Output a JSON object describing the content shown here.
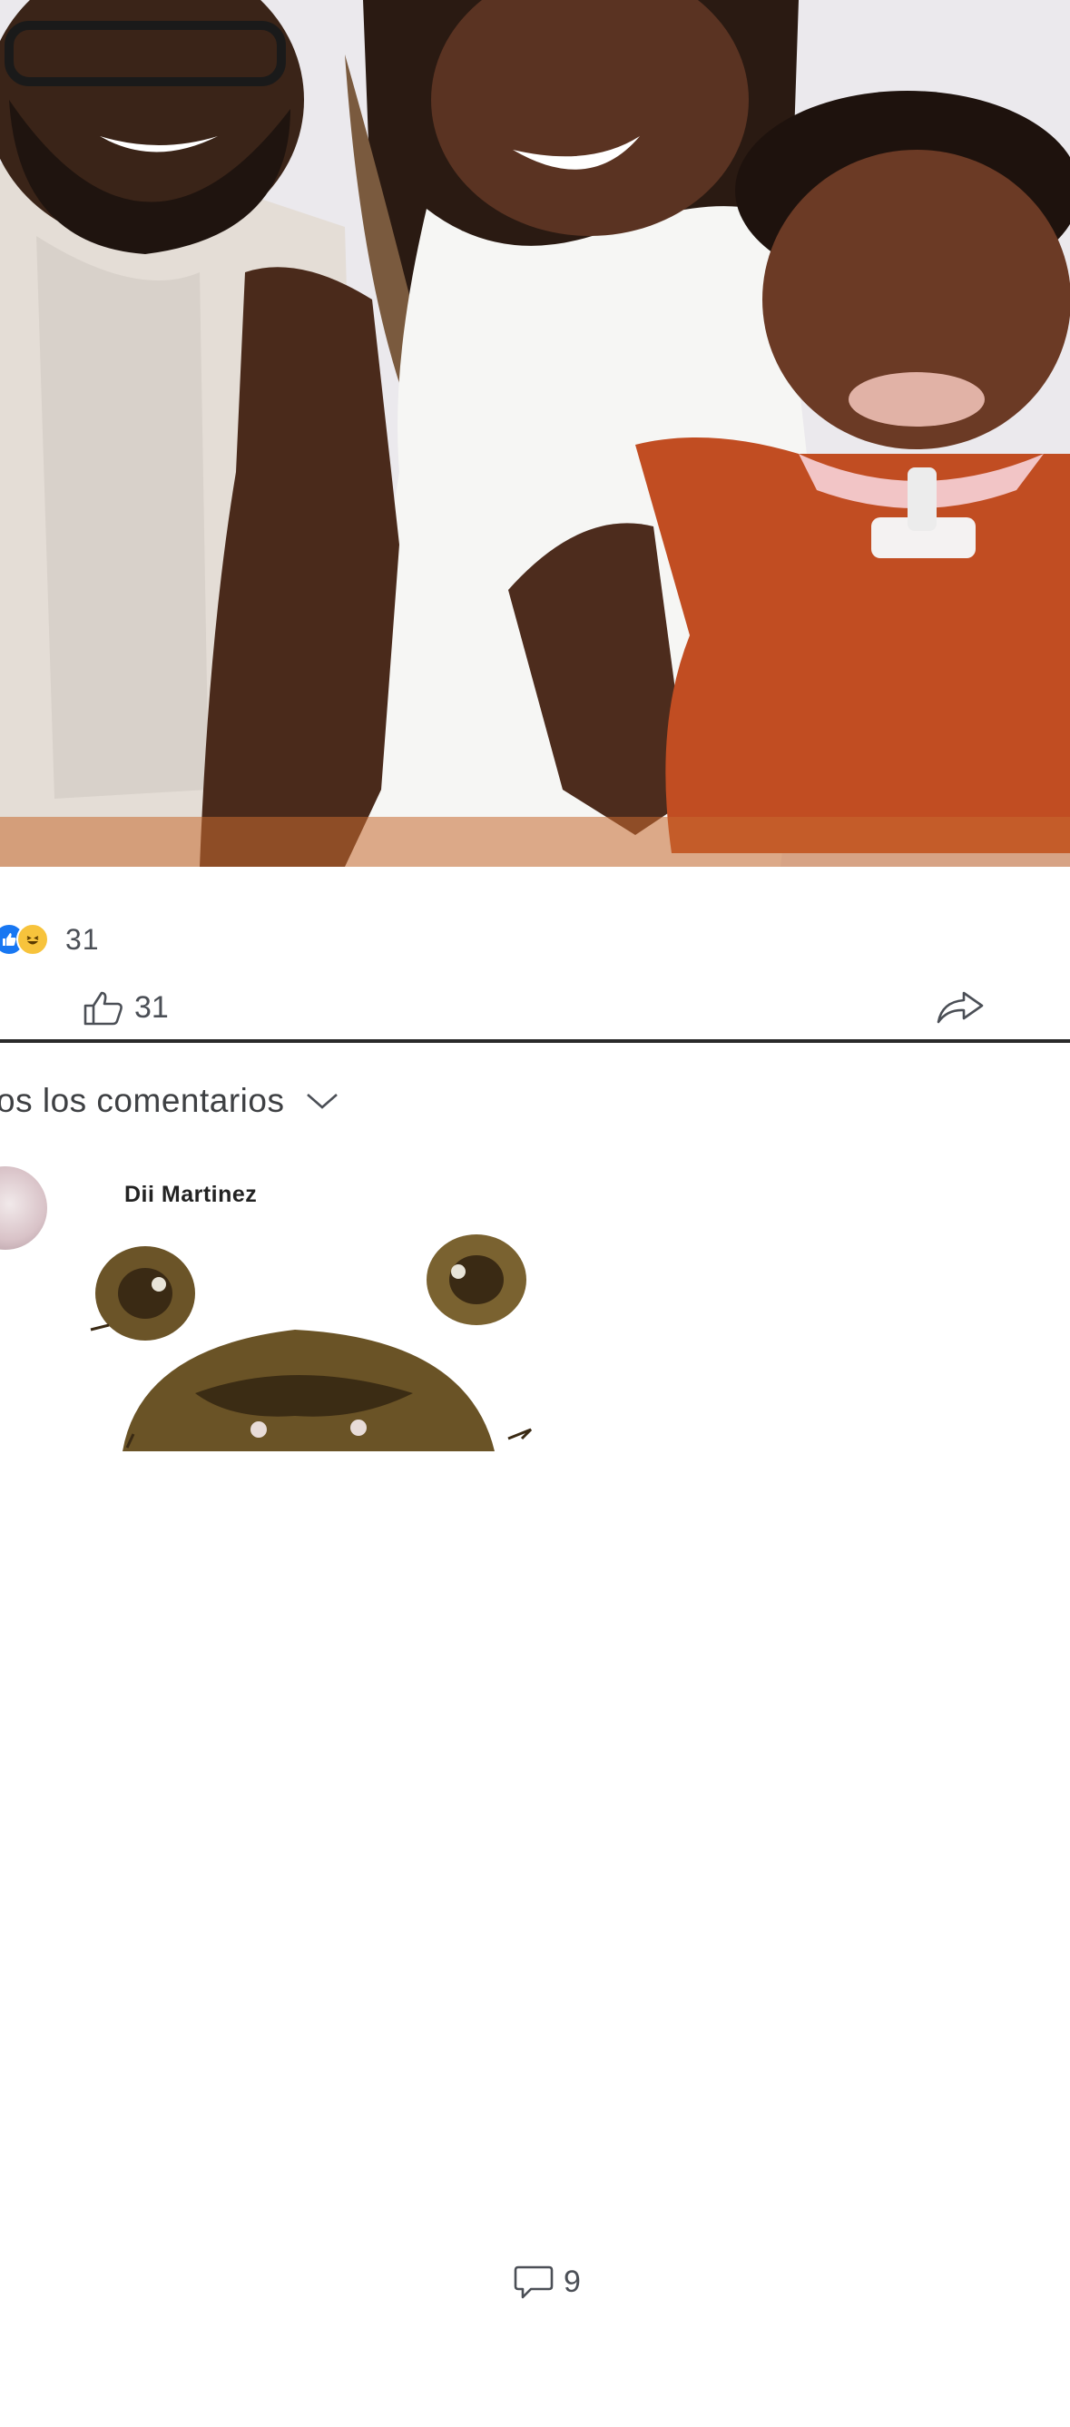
{
  "post": {
    "reactions": {
      "icons": [
        "like-icon",
        "haha-icon"
      ],
      "count": "31"
    },
    "actions": {
      "like_count": "31",
      "comment_count": "9",
      "icons": [
        "thumb-up-icon",
        "comment-bubble-icon",
        "share-arrow-icon"
      ]
    }
  },
  "comments_section": {
    "filter_label": "os los comentarios",
    "filter_icon": "chevron-down-icon"
  },
  "comment": {
    "author": "Dii Martinez",
    "sticker": "bear-sticker"
  },
  "colors": {
    "like_blue": "#1877f2",
    "haha_yellow": "#f7c33c",
    "text_gray": "#4b4f56"
  }
}
